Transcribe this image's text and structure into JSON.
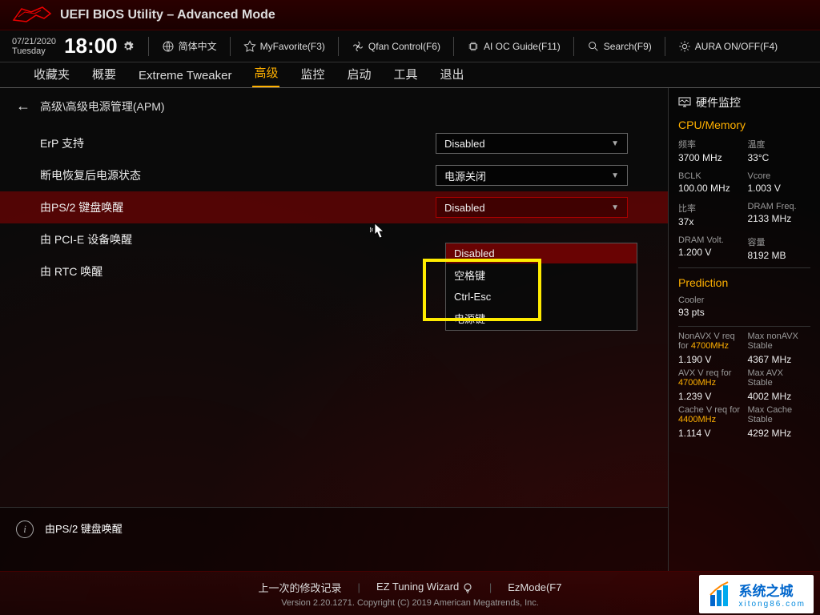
{
  "header": {
    "title": "UEFI BIOS Utility – Advanced Mode"
  },
  "datetime": {
    "date": "07/21/2020",
    "day": "Tuesday",
    "time": "18:00"
  },
  "toolbar": {
    "language": "简体中文",
    "favorite": "MyFavorite(F3)",
    "qfan": "Qfan Control(F6)",
    "aioc": "AI OC Guide(F11)",
    "search": "Search(F9)",
    "aura": "AURA ON/OFF(F4)"
  },
  "tabs": [
    "收藏夹",
    "概要",
    "Extreme Tweaker",
    "高级",
    "监控",
    "启动",
    "工具",
    "退出"
  ],
  "active_tab_index": 3,
  "breadcrumb": "高级\\高级电源管理(APM)",
  "settings": [
    {
      "label": "ErP 支持",
      "value": "Disabled"
    },
    {
      "label": "断电恢复后电源状态",
      "value": "电源关闭"
    },
    {
      "label": "由PS/2 键盘唤醒",
      "value": "Disabled",
      "selected": true
    },
    {
      "label": "由 PCI-E 设备唤醒",
      "value": ""
    },
    {
      "label": "由 RTC 唤醒",
      "value": ""
    }
  ],
  "dropdown_options": [
    "Disabled",
    "空格键",
    "Ctrl-Esc",
    "电源键"
  ],
  "dropdown_highlighted_index": 0,
  "help_text": "由PS/2 键盘唤醒",
  "sidebar": {
    "title": "硬件监控",
    "section1": "CPU/Memory",
    "stats1": [
      {
        "label": "频率",
        "value": "3700 MHz"
      },
      {
        "label": "温度",
        "value": "33°C"
      },
      {
        "label": "BCLK",
        "value": "100.00 MHz"
      },
      {
        "label": "Vcore",
        "value": "1.003 V"
      },
      {
        "label": "比率",
        "value": "37x"
      },
      {
        "label": "DRAM Freq.",
        "value": "2133 MHz"
      },
      {
        "label": "DRAM Volt.",
        "value": "1.200 V"
      },
      {
        "label": "容量",
        "value": "8192 MB"
      }
    ],
    "section2": "Prediction",
    "cooler_label": "Cooler",
    "cooler_value": "93 pts",
    "predictions": [
      {
        "label_pre": "NonAVX V req for ",
        "label_hl": "4700MHz",
        "right_label": "Max nonAVX Stable",
        "left_val": "1.190 V",
        "right_val": "4367 MHz"
      },
      {
        "label_pre": "AVX V req for ",
        "label_hl": "4700MHz",
        "right_label": "Max AVX Stable",
        "left_val": "1.239 V",
        "right_val": "4002 MHz"
      },
      {
        "label_pre": "Cache V req for ",
        "label_hl": "4400MHz",
        "right_label": "Max Cache Stable",
        "left_val": "1.114 V",
        "right_val": "4292 MHz"
      }
    ]
  },
  "footer": {
    "links": [
      "上一次的修改记录",
      "EZ Tuning Wizard",
      "EzMode(F7"
    ],
    "copyright": "Version 2.20.1271. Copyright (C) 2019 American Megatrends, Inc."
  },
  "watermark": {
    "title": "系统之城",
    "url": "xitong86.com"
  }
}
